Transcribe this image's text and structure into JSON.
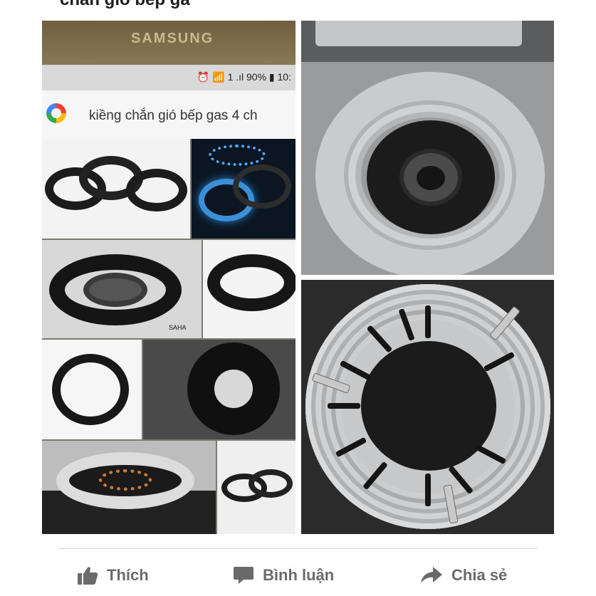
{
  "post": {
    "title": "chắn gió bếp ga"
  },
  "left_photo": {
    "brand": "SAMSUNG",
    "status_bar": "⏰ 📶 1 .ıl 90% ▮ 10:",
    "battery": "90%",
    "search_query": "kiềng chắn gió bếp gas 4 ch",
    "watermark": "SAHA"
  },
  "actions": {
    "like": "Thích",
    "comment": "Bình luận",
    "share": "Chia sẻ"
  },
  "colors": {
    "action_text": "#6a6a6a",
    "divider": "#d8d8d8"
  }
}
